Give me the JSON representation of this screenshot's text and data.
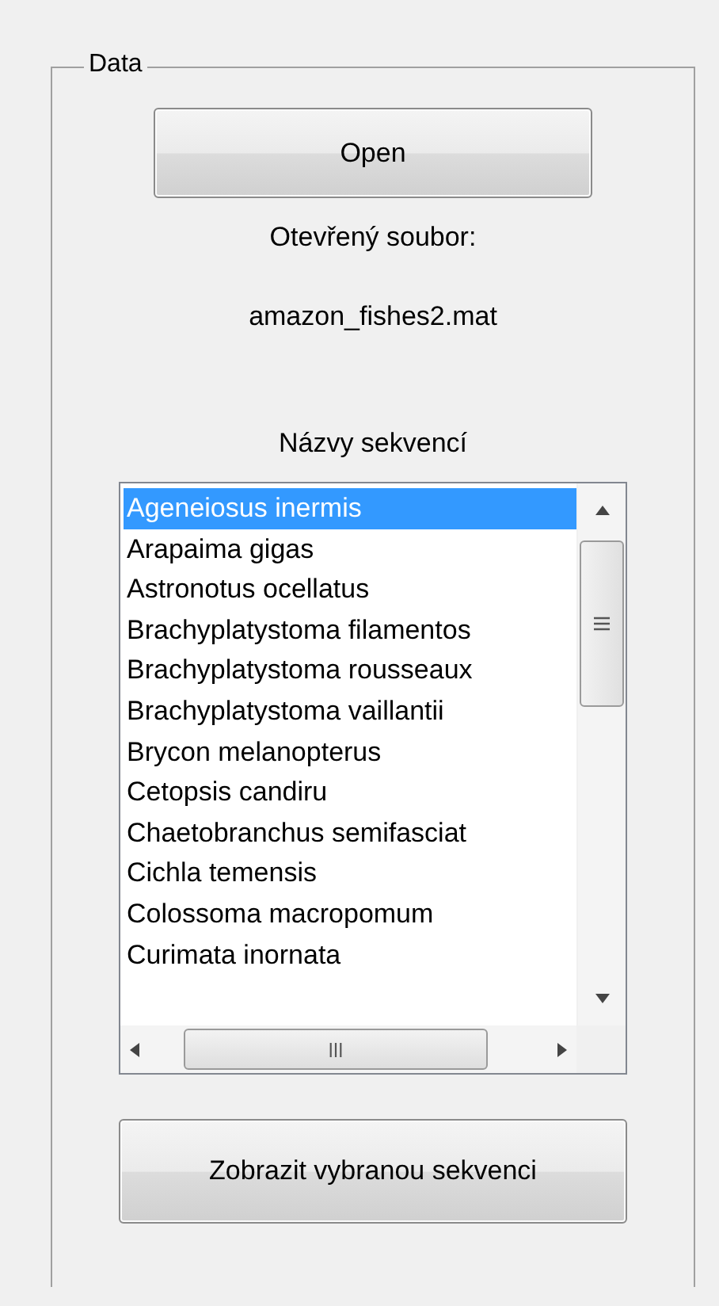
{
  "panel": {
    "title": "Data"
  },
  "open_button": {
    "label": "Open"
  },
  "file_label": "Otevřený soubor:",
  "file_name": "amazon_fishes2.mat",
  "list_label": "Názvy sekvencí",
  "sequences": [
    {
      "name": "Ageneiosus inermis",
      "selected": true
    },
    {
      "name": "Arapaima gigas",
      "selected": false
    },
    {
      "name": "Astronotus ocellatus",
      "selected": false
    },
    {
      "name": "Brachyplatystoma filamentos",
      "selected": false
    },
    {
      "name": "Brachyplatystoma rousseaux",
      "selected": false
    },
    {
      "name": "Brachyplatystoma vaillantii",
      "selected": false
    },
    {
      "name": "Brycon melanopterus",
      "selected": false
    },
    {
      "name": "Cetopsis candiru",
      "selected": false
    },
    {
      "name": "Chaetobranchus semifasciat",
      "selected": false
    },
    {
      "name": "Cichla temensis",
      "selected": false
    },
    {
      "name": "Colossoma macropomum",
      "selected": false
    },
    {
      "name": "Curimata inornata",
      "selected": false
    }
  ],
  "show_button": {
    "label": "Zobrazit vybranou sekvenci"
  }
}
